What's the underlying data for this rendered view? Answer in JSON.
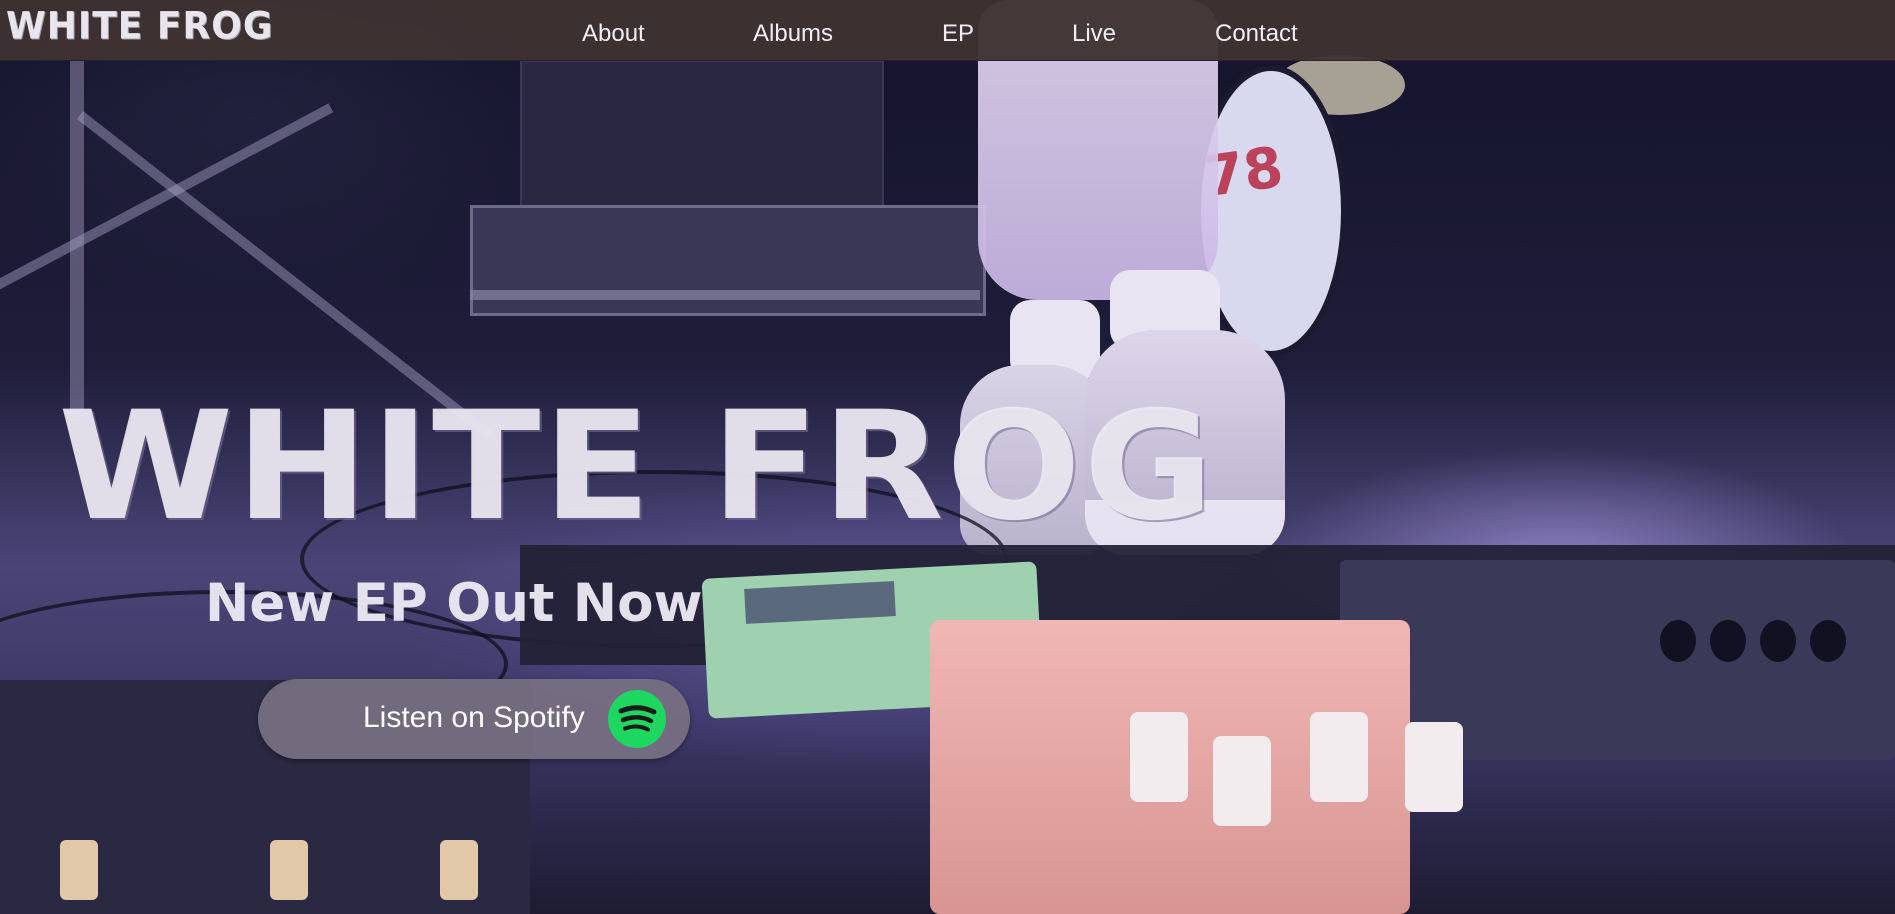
{
  "nav": {
    "logo": "WHITE FROG",
    "links": [
      "About",
      "Albums",
      "EP",
      "Live",
      "Contact"
    ]
  },
  "hero": {
    "title": "WHITE FROG",
    "subtitle": "New EP Out Now",
    "cta_label": "Listen on Spotify",
    "cta_icon": "spotify-icon",
    "background": "concert-stage-photo",
    "drum_text": "78"
  },
  "colors": {
    "nav_bg": "#3e3232",
    "text_light": "#ece9f2",
    "button_bg": "#787082",
    "spotify_green": "#1ed760"
  }
}
